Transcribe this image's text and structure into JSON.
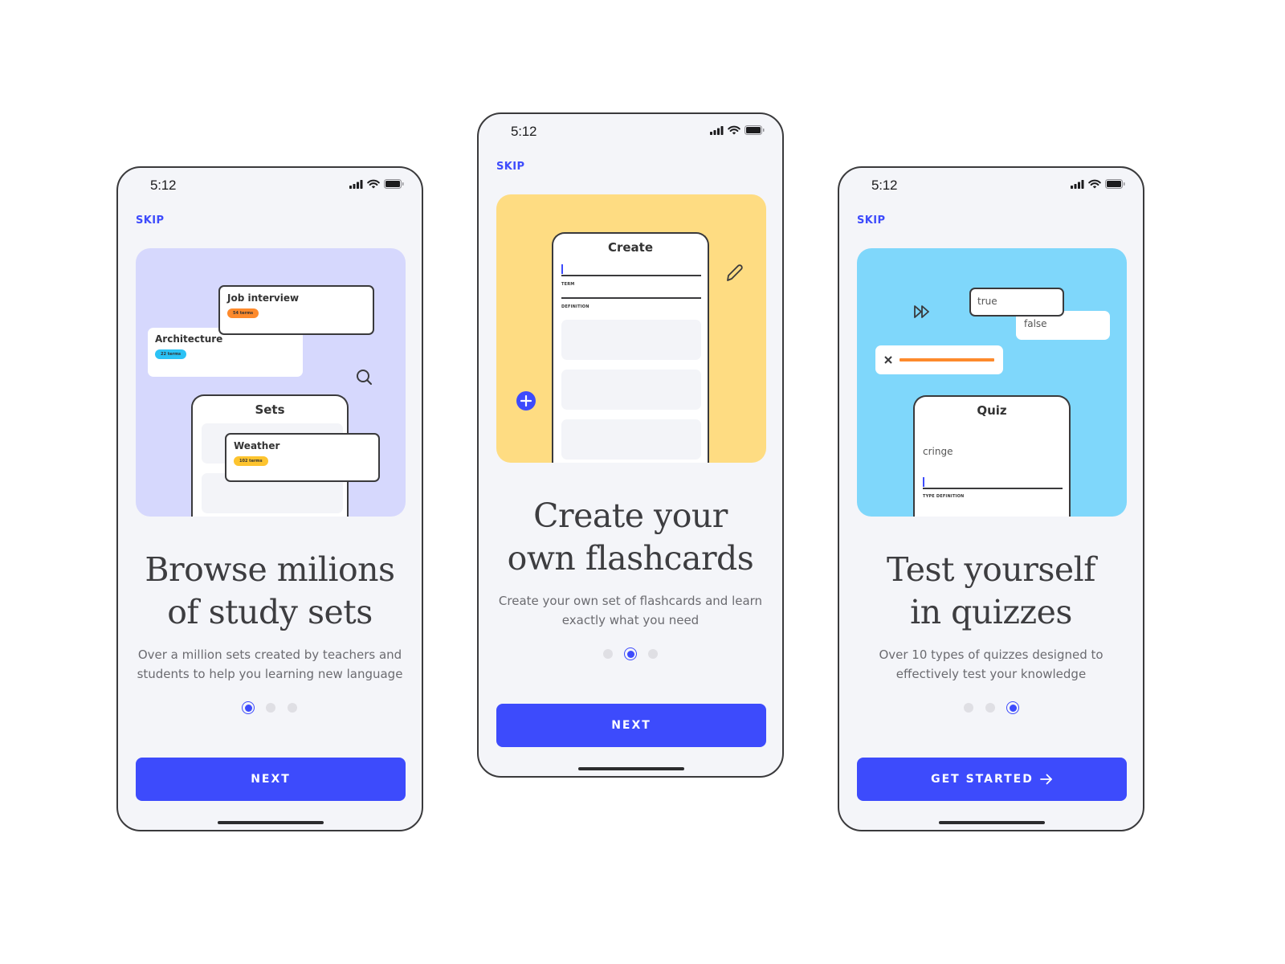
{
  "status_bar": {
    "time": "5:12"
  },
  "screens": [
    {
      "skip_label": "SKIP",
      "illustration": {
        "cards": [
          {
            "title": "Job interview",
            "badge": "54 terms",
            "badge_color": "#fd8a2c"
          },
          {
            "title": "Architecture",
            "badge": "22 terms",
            "badge_color": "#2bc2f5"
          },
          {
            "title": "Weather",
            "badge": "102 terms",
            "badge_color": "#fdc42f"
          }
        ],
        "mini_phone_title": "Sets"
      },
      "headline_line1": "Browse milions",
      "headline_line2": "of study sets",
      "subtext_line1": "Over a million sets created by teachers and",
      "subtext_line2": "students to help you learning new language",
      "active_page": 1,
      "page_count": 3,
      "cta_label": "NEXT"
    },
    {
      "skip_label": "SKIP",
      "illustration": {
        "mini_phone_title": "Create",
        "field_1_label": "TERM",
        "field_2_label": "DEFINITION"
      },
      "headline_line1": "Create your",
      "headline_line2": "own flashcards",
      "subtext_line1": "Create your own set of flashcards and learn",
      "subtext_line2": "exactly what you need",
      "active_page": 2,
      "page_count": 3,
      "cta_label": "NEXT"
    },
    {
      "skip_label": "SKIP",
      "illustration": {
        "option_true": "true",
        "option_false": "false",
        "mini_phone_title": "Quiz",
        "quiz_word": "cringe",
        "field_label": "TYPE DEFINITION"
      },
      "headline_line1": "Test yourself",
      "headline_line2": "in quizzes",
      "subtext_line1": "Over 10 types of quizzes designed to",
      "subtext_line2": "effectively test your knowledge",
      "active_page": 3,
      "page_count": 3,
      "cta_label": "GET STARTED"
    }
  ],
  "colors": {
    "accent": "#3d4bfc",
    "purple_bg": "#d6d8fd",
    "yellow_bg": "#fedc82",
    "blue_bg": "#7fd7fb",
    "progress_orange": "#fd8a2c"
  }
}
